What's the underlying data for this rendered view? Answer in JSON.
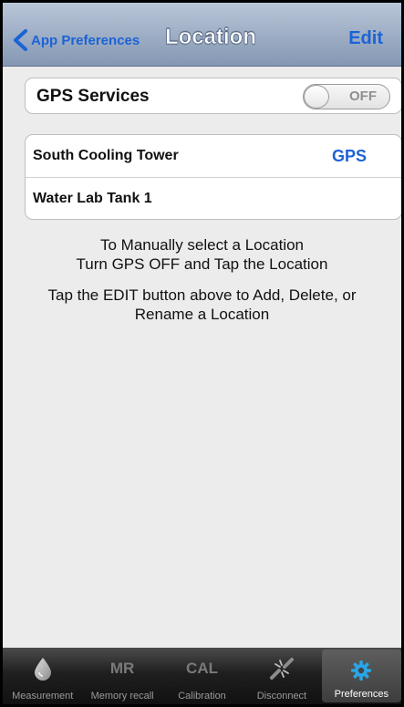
{
  "nav": {
    "back_label": "App Preferences",
    "title": "Location",
    "edit_label": "Edit"
  },
  "gps_services": {
    "label": "GPS Services",
    "toggle_state": "OFF"
  },
  "locations": [
    {
      "name": "South Cooling Tower",
      "badge": "GPS"
    },
    {
      "name": "Water Lab Tank 1",
      "badge": ""
    }
  ],
  "info": {
    "manual_line1": "To Manually select a Location",
    "manual_line2": "Turn GPS OFF and Tap the Location",
    "edit_line1": "Tap the EDIT button above to Add, Delete, or",
    "edit_line2": "Rename a Location"
  },
  "tabbar": {
    "tabs": [
      {
        "label": "Measurement",
        "icon": "water-drop-icon"
      },
      {
        "label": "Memory recall",
        "icon_text": "MR"
      },
      {
        "label": "Calibration",
        "icon_text": "CAL"
      },
      {
        "label": "Disconnect",
        "icon": "disconnect-icon"
      },
      {
        "label": "Preferences",
        "icon": "gear-icon",
        "selected": true
      }
    ]
  },
  "colors": {
    "accent_blue": "#1b63d6",
    "nav_gradient_top": "#b9c6d8",
    "nav_gradient_bottom": "#8497b3",
    "background": "#ececec",
    "tab_selected_icon": "#2aa6e6"
  }
}
